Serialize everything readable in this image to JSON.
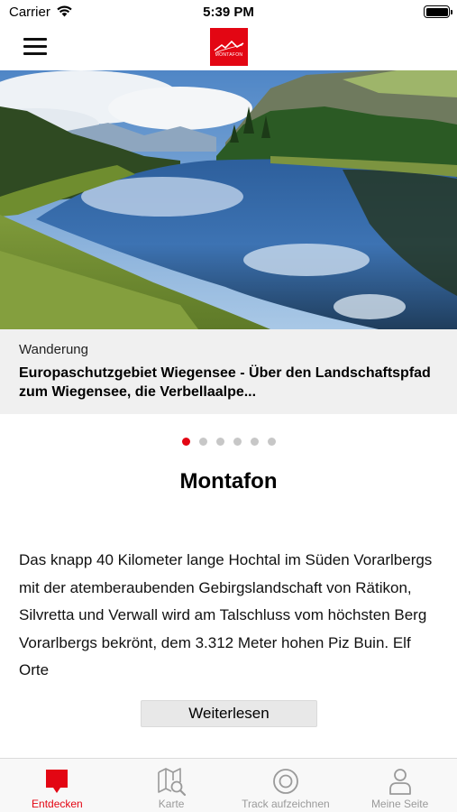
{
  "status_bar": {
    "carrier": "Carrier",
    "time": "5:39 PM"
  },
  "header": {
    "logo_text": "MONTAFON",
    "logo_color": "#e30613"
  },
  "hero": {
    "category": "Wanderung",
    "title": "Europaschutzgebiet Wiegensee - Über den Landschaftspfad zum Wiegensee, die Verbellaalpe...",
    "image": "mountain lake landscape"
  },
  "pager": {
    "count": 6,
    "active_index": 0
  },
  "section": {
    "title": "Montafon",
    "description": "Das knapp 40 Kilometer lange Hochtal im Süden Vorarlbergs mit der atemberaubenden Gebirgslandschaft von Rätikon, Silvretta und Verwall wird am Talschluss vom höchsten Berg Vorarlbergs bekrönt, dem 3.312 Meter hohen Piz Buin. Elf Orte",
    "read_more_label": "Weiterlesen"
  },
  "tab_bar": {
    "tabs": [
      {
        "label": "Entdecken",
        "icon": "chat-bubble-icon",
        "active": true
      },
      {
        "label": "Karte",
        "icon": "map-search-icon",
        "active": false
      },
      {
        "label": "Track aufzeichnen",
        "icon": "record-track-icon",
        "active": false
      },
      {
        "label": "Meine Seite",
        "icon": "person-icon",
        "active": false
      }
    ]
  },
  "colors": {
    "accent": "#e30613",
    "inactive": "#9a9a9a",
    "caption_background": "#f0f0f0"
  }
}
